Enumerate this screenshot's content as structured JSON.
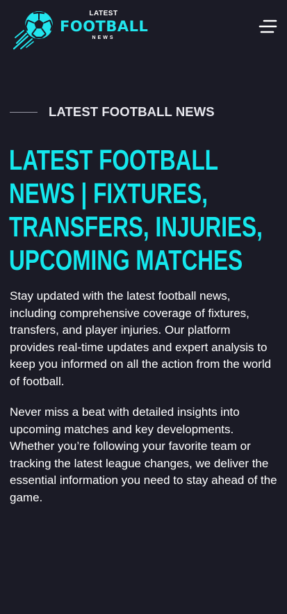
{
  "logo": {
    "top": "LATEST",
    "main": "FOOTBALL",
    "sub": "NEWS",
    "accent_color": "#22e6ee",
    "icon": "football-icon"
  },
  "menu": {
    "icon": "hamburger-menu-icon"
  },
  "hero": {
    "eyebrow": "LATEST FOOTBALL NEWS",
    "title": "LATEST FOOTBALL NEWS | FIXTURES, TRANSFERS, INJURIES, UPCOMING MATCHES",
    "paragraphs": [
      "Stay updated with the latest football news, including comprehensive coverage of fixtures, transfers, and player injuries. Our platform provides real-time updates and expert analysis to keep you informed on all the action from the world of football.",
      "Never miss a beat with detailed insights into upcoming matches and key developments. Whether you’re following your favorite team or tracking the latest league changes, we deliver the essential information you need to stay ahead of the game."
    ]
  },
  "colors": {
    "background": "#1b1b26",
    "accent": "#14e8ee",
    "text": "#ffffff"
  }
}
